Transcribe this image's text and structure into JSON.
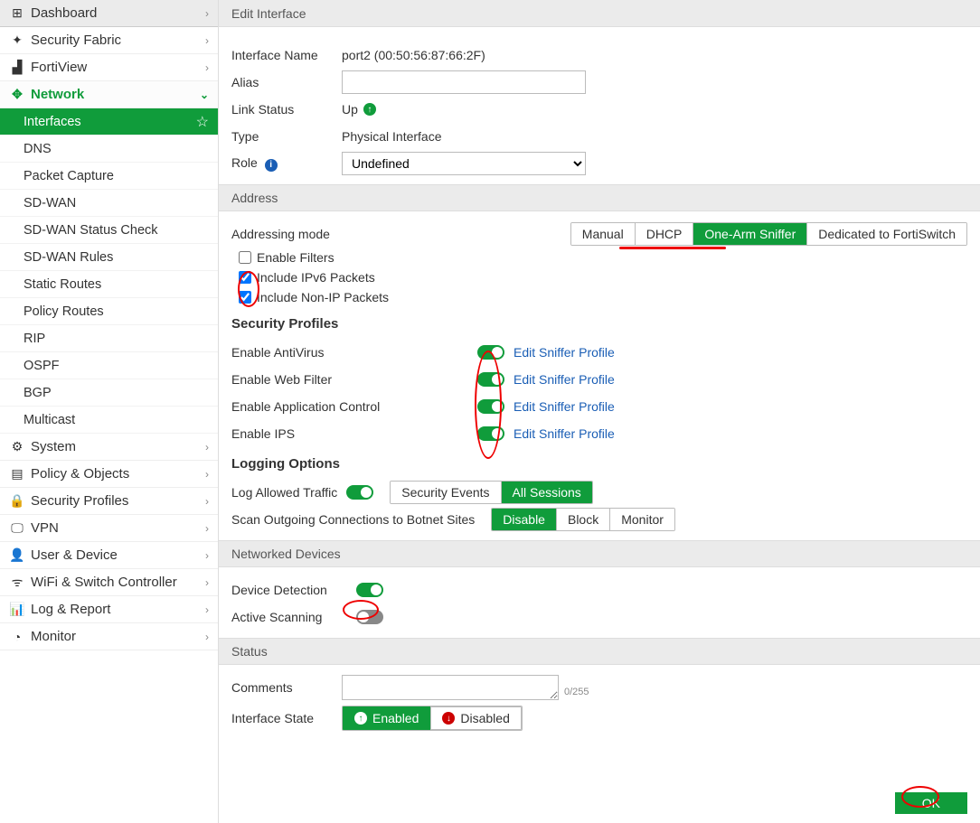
{
  "nav": {
    "dashboard": "Dashboard",
    "security_fabric": "Security Fabric",
    "fortiview": "FortiView",
    "network": "Network",
    "network_items": [
      "Interfaces",
      "DNS",
      "Packet Capture",
      "SD-WAN",
      "SD-WAN Status Check",
      "SD-WAN Rules",
      "Static Routes",
      "Policy Routes",
      "RIP",
      "OSPF",
      "BGP",
      "Multicast"
    ],
    "system": "System",
    "policy_objects": "Policy & Objects",
    "security_profiles": "Security Profiles",
    "vpn": "VPN",
    "user_device": "User & Device",
    "wifi_switch": "WiFi & Switch Controller",
    "log_report": "Log & Report",
    "monitor": "Monitor"
  },
  "page": {
    "title": "Edit Interface",
    "interface_name_label": "Interface Name",
    "interface_name_value": "port2 (00:50:56:87:66:2F)",
    "alias_label": "Alias",
    "alias_value": "",
    "link_status_label": "Link Status",
    "link_status_value": "Up",
    "type_label": "Type",
    "type_value": "Physical Interface",
    "role_label": "Role",
    "role_value": "Undefined"
  },
  "address": {
    "header": "Address",
    "mode_label": "Addressing mode",
    "modes": [
      "Manual",
      "DHCP",
      "One-Arm Sniffer",
      "Dedicated to FortiSwitch"
    ],
    "mode_selected": "One-Arm Sniffer",
    "enable_filters": "Enable Filters",
    "ipv6": "Include IPv6 Packets",
    "nonip": "Include Non-IP Packets"
  },
  "sec": {
    "header": "Security Profiles",
    "rows": [
      {
        "label": "Enable AntiVirus",
        "link": "Edit Sniffer Profile"
      },
      {
        "label": "Enable Web Filter",
        "link": "Edit Sniffer Profile"
      },
      {
        "label": "Enable Application Control",
        "link": "Edit Sniffer Profile"
      },
      {
        "label": "Enable IPS",
        "link": "Edit Sniffer Profile"
      }
    ]
  },
  "logging": {
    "header": "Logging Options",
    "allowed_label": "Log Allowed Traffic",
    "allowed_opts": [
      "Security Events",
      "All Sessions"
    ],
    "allowed_selected": "All Sessions",
    "botnet_label": "Scan Outgoing Connections to Botnet Sites",
    "botnet_opts": [
      "Disable",
      "Block",
      "Monitor"
    ],
    "botnet_selected": "Disable"
  },
  "netdev": {
    "header": "Networked Devices",
    "detection": "Device Detection",
    "scanning": "Active Scanning"
  },
  "status": {
    "header": "Status",
    "comments_label": "Comments",
    "comments_count": "0/255",
    "state_label": "Interface State",
    "enabled": "Enabled",
    "disabled": "Disabled"
  },
  "buttons": {
    "ok": "OK"
  }
}
